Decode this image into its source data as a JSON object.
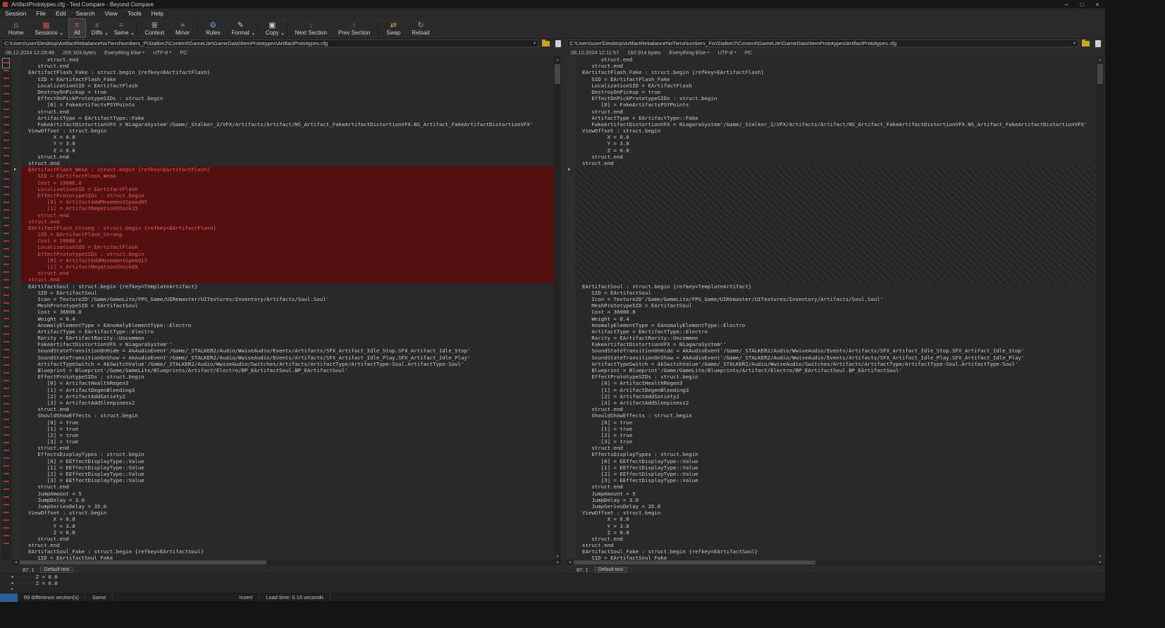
{
  "window": {
    "title": "ArtifactPrototypes.cfg - Text Compare - Beyond Compare",
    "minimize": "–",
    "maximize": "□",
    "close": "×"
  },
  "menu": [
    "Session",
    "File",
    "Edit",
    "Search",
    "View",
    "Tools",
    "Help"
  ],
  "icons": {
    "caret_down": "▾",
    "scroll_up": "▲",
    "scroll_down": "▼",
    "scroll_left": "◄",
    "scroll_right": "►",
    "marker_arrow": "▸"
  },
  "colors": {
    "removed_line_bg": "#531010",
    "removed_line_text": "#e85c5c",
    "diff_marker": "#e2c63a",
    "diff_map_tick": "#a83434",
    "statusbar_badge": "#2e5f94"
  },
  "toolbar": [
    {
      "label": "Home",
      "icon": "home-icon",
      "glyph": "⌂",
      "color": "#d8d8d8"
    },
    {
      "label": "Sessions",
      "icon": "sessions-icon",
      "glyph": "▦",
      "color": "#c95050",
      "caret": true
    },
    {
      "sep": true
    },
    {
      "label": "All",
      "icon": "all-icon",
      "glyph": "≡",
      "color": "#cf5a5a",
      "active": true
    },
    {
      "label": "Diffs",
      "icon": "diffs-icon",
      "glyph": "≠",
      "color": "#cf5a5a",
      "caret": true
    },
    {
      "label": "Same",
      "icon": "same-icon",
      "glyph": "=",
      "color": "#6f9fd8",
      "caret": true
    },
    {
      "sep": true
    },
    {
      "label": "Context",
      "icon": "context-icon",
      "glyph": "≣",
      "color": "#9fb6cf"
    },
    {
      "label": "Minor",
      "icon": "minor-icon",
      "glyph": "≈",
      "color": "#9fb6cf"
    },
    {
      "sep": true
    },
    {
      "label": "Rules",
      "icon": "rules-icon",
      "glyph": "⚙",
      "color": "#6f9fd8"
    },
    {
      "label": "Format",
      "icon": "format-icon",
      "glyph": "✎",
      "color": "#d8c86f",
      "caret": true
    },
    {
      "sep": true
    },
    {
      "label": "Copy",
      "icon": "copy-icon",
      "glyph": "▣",
      "color": "#c9c9c9",
      "caret": true
    },
    {
      "sep": true
    },
    {
      "label": "Next Section",
      "icon": "next-section-icon",
      "glyph": "↓",
      "color": "#cf5a5a"
    },
    {
      "label": "Prev Section",
      "icon": "prev-section-icon",
      "glyph": "↑",
      "color": "#cf5a5a"
    },
    {
      "sep": true
    },
    {
      "label": "Swap",
      "icon": "swap-icon",
      "glyph": "⇄",
      "color": "#cf8f5a"
    },
    {
      "label": "Reload",
      "icon": "reload-icon",
      "glyph": "↻",
      "color": "#7ab85c"
    }
  ],
  "left_pane": {
    "path": "C:\\Users\\user\\Desktop\\ArtifactRebalanceNoTiersNumbers_P\\Stalker2\\Content\\GameLite\\GameData\\ItemPrototypes\\ArtifactPrototypes.cfg",
    "modified": "06.12.2024 12:28:49",
    "size": "205 303 bytes",
    "rule": "Everything Else",
    "encoding": "UTF-8",
    "crlf": "PC",
    "caret_pos": "87: 1",
    "grammar": "Default text"
  },
  "right_pane": {
    "path": "C:\\Users\\user\\Desktop\\ArtifactRebalanceNoTiersNumbers_Fix\\Stalker2\\Content\\GameLite\\GameData\\ItemPrototypes\\ArtifactPrototypes.cfg",
    "modified": "06.12.2024 12:11:57",
    "size": "160 914 bytes",
    "rule": "Everything Else",
    "encoding": "UTF-8",
    "crlf": "PC",
    "caret_pos": "87: 1",
    "grammar": "Default text"
  },
  "code": {
    "common_top": [
      "      struct.end",
      "   struct.end",
      "EArtifactFlash_Fake : struct.begin {refkey=EArtifactFlash}",
      "   SID = EArtifactFlash_Fake",
      "   LocalizationSID = EArtifactFlash",
      "   DestroyOnPickup = true",
      "   EffectOnPickPrototypeSIDs : struct.begin",
      "      [0] = FakeArtifactsPSYPoints",
      "   struct.end",
      "   ArtifactType = EArtifactType::Fake",
      "   FakeArtifactDistortionVFX = NiagaraSystem'/Game/_Stalker_2/VFX/Artifacts/Artifact/NS_Artifact_FakeArtifactDistortionVFX.NS_Artifact_FakeArtifactDistortionVFX'",
      "ViewOffset : struct.begin",
      "        X = 0.0",
      "        Y = 3.0",
      "        Z = 0.0",
      "   struct.end",
      "struct.end"
    ],
    "left_only": [
      "EArtifactFlash_Weak : struct.begin {refkey=EArtifactFlash}",
      "   SID = EArtifactFlash_Weak",
      "   Cost = 10000.0",
      "   LocalizationSID = EArtifactFlash",
      "   EffectPrototypeSIDs : struct.begin",
      "      [0] = ArtifactAddMovementSpeed05",
      "      [1] = ArtifactNegationShock15",
      "   struct.end",
      "struct.end",
      "EArtifactFlash_Strong : struct.begin {refkey=EArtifactFlash}",
      "   SID = EArtifactFlash_Strong",
      "   Cost = 20000.0",
      "   LocalizationSID = EArtifactFlash",
      "   EffectPrototypeSIDs : struct.begin",
      "      [0] = ArtifactAddMovementSpeed15",
      "      [1] = ArtifactNegationShock05",
      "   struct.end",
      "struct.end"
    ],
    "gap_count": 18,
    "common_bottom": [
      "EArtifactSoul : struct.begin {refkey=TemplateArtifact}",
      "   SID = EArtifactSoul",
      "   Icon = Texture2D'/Game/GameLite/FPS_Game/UIRemaster/UITextures/Inventory/Artifacts/Soul.Soul'",
      "   MeshPrototypeSID = EArtifactSoul",
      "   Cost = 36000.0",
      "   Weight = 0.4",
      "   AnomalyElementType = EAnomalyElementType::Electro",
      "   ArtifactType = EArtifactType::Electro",
      "   Rarity = EArtifactRarity::Uncommon",
      "   FakeArtifactDistortionVFX = NiagaraSystem''",
      "   SoundStateTransitionOnHide = AkAudioEvent'/Game/_STALKER2/Audio/WwiseAudio/Events/Artifacts/SFX_Artifact_Idle_Stop.SFX_Artifact_Idle_Stop'",
      "   SoundStateTransitionOnShow = AkAudioEvent'/Game/_STALKER2/Audio/WwiseAudio/Events/Artifacts/SFX_Artifact_Idle_Play.SFX_Artifact_Idle_Play'",
      "   ArtifactTypeSwitch = AkSwitchValue'/Game/_STALKER2/Audio/WwiseAudio/Switches/Artifacts/ArtifactType/ArtifactType-Soul.ArtifactType-Soul'",
      "   Blueprint = Blueprint'/Game/GameLite/Blueprints/Artifact/Electro/BP_EArtifactSoul.BP_EArtifactSoul'",
      "   EffectPrototypeSIDs : struct.begin",
      "      [0] = ArtifactHealthRegen3",
      "      [1] = ArtifactDegenBleeding3",
      "      [2] = ArtifactAddSatiety2",
      "      [3] = ArtifactAddSleepiness2",
      "   struct.end",
      "   ShouldShowEffects : struct.begin",
      "      [0] = true",
      "      [1] = true",
      "      [2] = true",
      "      [3] = true",
      "   struct.end",
      "   EffectsDisplayTypes : struct.begin",
      "      [0] = EEffectDisplayType::Value",
      "      [1] = EEffectDisplayType::Value",
      "      [2] = EEffectDisplayType::Value",
      "      [3] = EEffectDisplayType::Value",
      "   struct.end",
      "   JumpAmount = 5",
      "   JumpDelay = 3.0",
      "   JumpSeriesDelay = 35.0",
      "ViewOffset : struct.begin",
      "        X = 0.0",
      "        Y = 3.0",
      "        Z = 0.0",
      "   struct.end",
      "struct.end",
      "EArtifactSoul_Fake : struct.begin {refkey=EArtifactSoul}",
      "   SID = EArtifactSoul_Fake"
    ]
  },
  "details": {
    "rows": [
      {
        "marker": "◄",
        "ws": "········",
        "text": "Z = 0.0"
      },
      {
        "marker": "◄",
        "ws": "········",
        "text": "Z = 0.0"
      }
    ]
  },
  "statusbar": {
    "diff_sections": "69 difference section(s)",
    "section_status": "Same",
    "edit_mode": "Insert",
    "load_time": "Load time: 0.16 seconds"
  }
}
